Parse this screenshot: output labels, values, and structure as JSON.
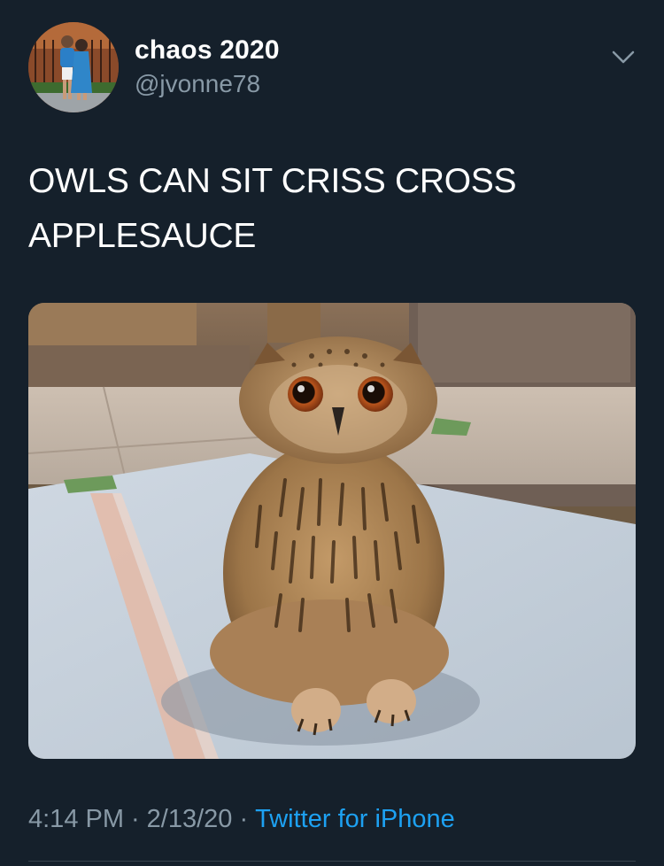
{
  "tweet": {
    "author": {
      "display_name": "chaos 2020",
      "handle": "@jvonne78",
      "avatar_icon": "profile-photo"
    },
    "more_menu_icon": "chevron-down-icon",
    "text_lines": [
      "OWLS CAN SIT CRISS CROSS",
      "APPLESAUCE"
    ],
    "media": {
      "type": "photo",
      "subject": "owl sitting on floor"
    },
    "meta": {
      "time": "4:14 PM",
      "separator": "·",
      "date": "2/13/20",
      "source": "Twitter for iPhone"
    }
  },
  "colors": {
    "background": "#15202b",
    "text_primary": "#ffffff",
    "text_secondary": "#8899a6",
    "link": "#1da1f2",
    "divider": "#38444d"
  }
}
